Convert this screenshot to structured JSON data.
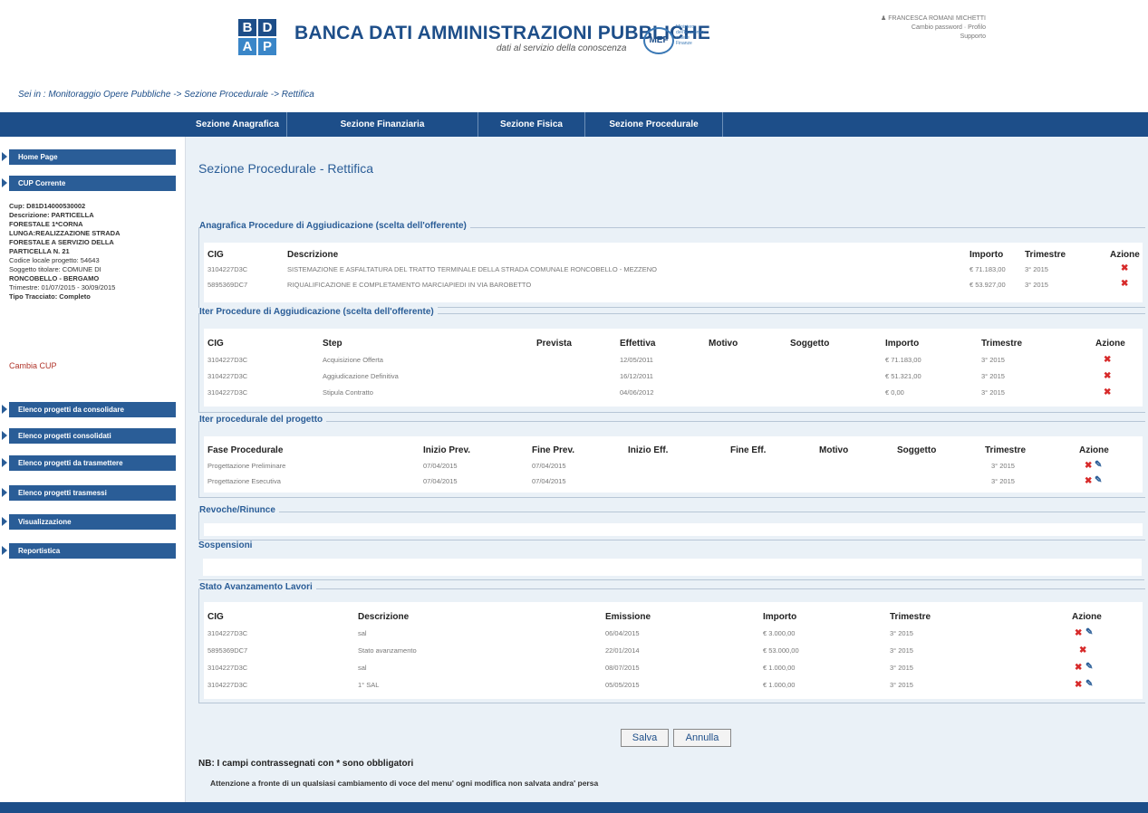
{
  "header": {
    "logo_letters": [
      "B",
      "D",
      "A",
      "P"
    ],
    "title": "BANCA DATI AMMINISTRAZIONI PUBBLICHE",
    "subtitle": "dati al servizio della conoscenza",
    "mef_logo": "MEF",
    "mef_text": "Ministero dell'Economia e delle Finanze",
    "user_line1": "FRANCESCA ROMANI MICHETTI",
    "user_line2": "Cambio password · Profilo",
    "user_line3": "Supporto",
    "user_icon": "user-icon"
  },
  "breadcrumb": "Sei in : Monitoraggio Opere Pubbliche -> Sezione Procedurale -> Rettifica",
  "nav": {
    "tabs": [
      "Sezione Anagrafica",
      "Sezione Finanziaria",
      "Sezione Fisica",
      "Sezione Procedurale"
    ]
  },
  "sidebar": {
    "home": "Home Page",
    "cup_corrente": "CUP Corrente",
    "cup_lines": [
      "Cup: D81D14000530002",
      "Descrizione: PARTICELLA",
      "FORESTALE 1*CORNA",
      "LUNGA:REALIZZAZIONE STRADA",
      "FORESTALE A SERVIZIO DELLA",
      "PARTICELLA N. 21",
      "Codice locale progetto: 54643",
      "Soggetto titolare: COMUNE DI",
      "RONCOBELLO - BERGAMO",
      "Trimestre: 01/07/2015 - 30/09/2015",
      "Tipo Tracciato: Completo"
    ],
    "cambia_cup": "Cambia CUP",
    "menu": [
      "Elenco progetti da consolidare",
      "Elenco progetti consolidati",
      "Elenco progetti da trasmettere",
      "Elenco progetti trasmessi",
      "Visualizzazione",
      "Reportistica"
    ]
  },
  "page_title": "Sezione Procedurale - Rettifica",
  "anagrafica": {
    "legend": "Anagrafica Procedure di Aggiudicazione (scelta dell'offerente)",
    "headers": [
      "CIG",
      "Descrizione",
      "Importo",
      "Trimestre",
      "Azione"
    ],
    "rows": [
      [
        "3104227D3C",
        "SISTEMAZIONE E ASFALTATURA DEL TRATTO TERMINALE DELLA STRADA COMUNALE RONCOBELLO - MEZZENO",
        "€ 71.183,00",
        "3° 2015"
      ],
      [
        "5895369DC7",
        "RIQUALIFICAZIONE E COMPLETAMENTO MARCIAPIEDI IN VIA BAROBETTO",
        "€ 53.927,00",
        "3° 2015"
      ]
    ]
  },
  "iter_aggiudicazione": {
    "legend": "Iter Procedure di Aggiudicazione (scelta dell'offerente)",
    "headers": [
      "CIG",
      "Step",
      "Prevista",
      "Effettiva",
      "Motivo",
      "Soggetto",
      "Importo",
      "Trimestre",
      "Azione"
    ],
    "rows": [
      [
        "3104227D3C",
        "Acquisizione Offerta",
        "12/05/2011",
        "€ 71.183,00",
        "3° 2015"
      ],
      [
        "3104227D3C",
        "Aggiudicazione Definitiva",
        "16/12/2011",
        "€ 51.321,00",
        "3° 2015"
      ],
      [
        "3104227D3C",
        "Stipula Contratto",
        "04/06/2012",
        "€ 0,00",
        "3° 2015"
      ]
    ]
  },
  "iter_progetto": {
    "legend": "Iter procedurale del progetto",
    "headers": [
      "Fase Procedurale",
      "Inizio Prev.",
      "Fine Prev.",
      "Inizio Eff.",
      "Fine Eff.",
      "Motivo",
      "Soggetto",
      "Trimestre",
      "Azione"
    ],
    "rows": [
      [
        "Progettazione Preliminare",
        "07/04/2015",
        "07/04/2015",
        "3° 2015"
      ],
      [
        "Progettazione Esecutiva",
        "07/04/2015",
        "07/04/2015",
        "3° 2015"
      ]
    ]
  },
  "revoche": {
    "legend": "Revoche/Rinunce"
  },
  "sospensioni": {
    "legend": "Sospensioni"
  },
  "sal": {
    "legend": "Stato Avanzamento Lavori",
    "headers": [
      "CIG",
      "Descrizione",
      "Emissione",
      "Importo",
      "Trimestre",
      "Azione"
    ],
    "rows": [
      [
        "3104227D3C",
        "sal",
        "06/04/2015",
        "€ 3.000,00",
        "3° 2015"
      ],
      [
        "5895369DC7",
        "Stato avanzamento",
        "22/01/2014",
        "€ 53.000,00",
        "3° 2015"
      ],
      [
        "3104227D3C",
        "sal",
        "08/07/2015",
        "€ 1.000,00",
        "3° 2015"
      ],
      [
        "3104227D3C",
        "1° SAL",
        "05/05/2015",
        "€ 1.000,00",
        "3° 2015"
      ]
    ]
  },
  "actions": {
    "delete_glyph": "✖",
    "edit_glyph": "✎",
    "delete_icon": "delete-icon",
    "edit_icon": "edit-icon"
  },
  "buttons": {
    "save": "Salva",
    "cancel": "Annulla"
  },
  "notes": {
    "required": "NB: I campi contrassegnati con * sono obbligatori",
    "warning": "Attenzione a fronte di un qualsiasi cambiamento di voce del menu' ogni modifica non salvata andra' persa"
  },
  "colors": {
    "primary": "#1d4e89",
    "sidebar_button": "#2a5d97",
    "delete": "#d72a2a",
    "panel": "#eaf1f7"
  }
}
